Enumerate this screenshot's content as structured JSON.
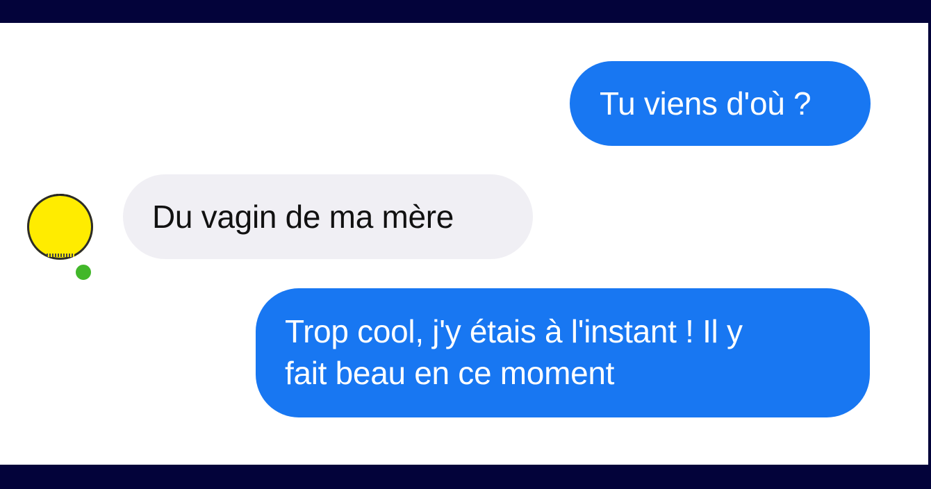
{
  "conversation": {
    "messages": [
      {
        "sender": "me",
        "text": "Tu viens d'où ?"
      },
      {
        "sender": "contact",
        "text": "Du vagin de ma mère"
      },
      {
        "sender": "me",
        "text": "Trop cool, j'y étais à l'instant ! Il y\nfait beau en ce moment"
      }
    ]
  },
  "contact": {
    "avatar_color": "#ffec00",
    "status": "online",
    "status_color": "#42b72a"
  },
  "colors": {
    "sent_bubble": "#1877f2",
    "received_bubble": "#f0eff4",
    "frame": "#03033a"
  }
}
